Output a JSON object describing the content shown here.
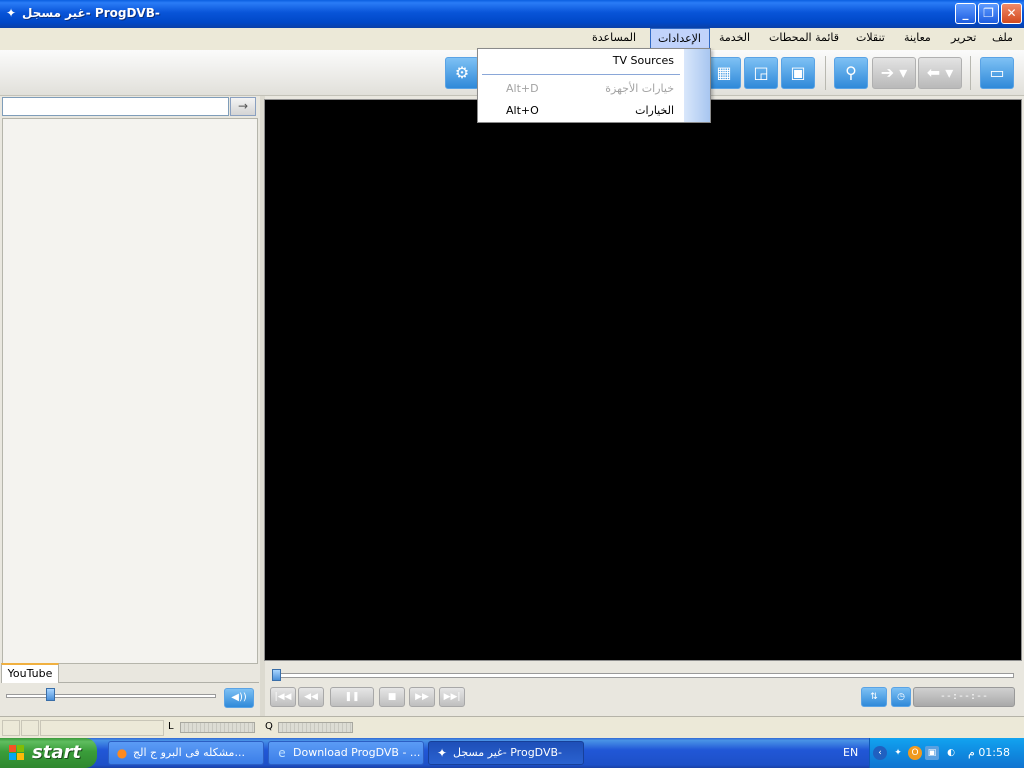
{
  "window": {
    "title": "غير مسجل- ProgDVB-"
  },
  "menubar": {
    "items": [
      {
        "label": "ملف"
      },
      {
        "label": "تحرير"
      },
      {
        "label": "معاينة"
      },
      {
        "label": "تنقلات"
      },
      {
        "label": "قائمة المحطات"
      },
      {
        "label": "الخدمة"
      },
      {
        "label": "الإعدادات"
      },
      {
        "label": "المساعدة"
      }
    ]
  },
  "dropdown": {
    "items": [
      {
        "label": "TV Sources",
        "accel": ""
      },
      {
        "label": "خيارات الأجهزة",
        "accel": "Alt+D"
      },
      {
        "label": "الخيارات",
        "accel": "Alt+O"
      }
    ]
  },
  "left_panel": {
    "search_value": "",
    "tab_label": "YouTube",
    "volume_fraction": 0.2
  },
  "player": {
    "seek_fraction": 0.0,
    "time": "--:--:--"
  },
  "statusbar": {
    "level_label": "L",
    "quality_label": "Q"
  },
  "taskbar": {
    "start_label": "start",
    "tasks": [
      {
        "label": "مشكله فى البرو ج الج..."
      },
      {
        "label": "Download ProgDVB - ..."
      },
      {
        "label": "غير مسجل- ProgDVB-"
      }
    ],
    "language": "EN",
    "clock": "01:58 م"
  }
}
